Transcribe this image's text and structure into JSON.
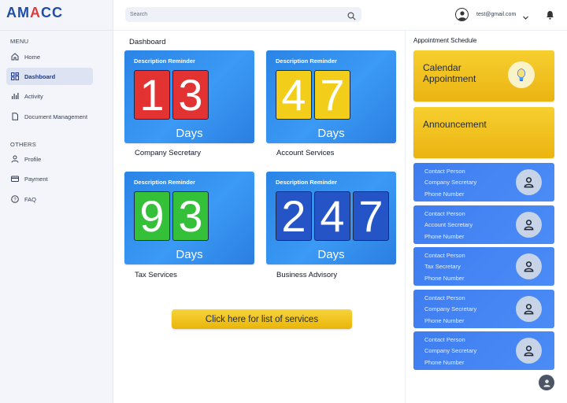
{
  "brand": {
    "logo_text_a": "AM",
    "logo_text_b": "A",
    "logo_text_c": "CC"
  },
  "sidebar": {
    "menu_heading": "MENU",
    "items": [
      {
        "label": "Home",
        "icon": "home-icon"
      },
      {
        "label": "Dashboard",
        "icon": "dashboard-icon",
        "active": true
      },
      {
        "label": "Activity",
        "icon": "activity-icon"
      },
      {
        "label": "Document Management",
        "icon": "document-icon"
      }
    ],
    "others_heading": "OTHERS",
    "others": [
      {
        "label": "Profile",
        "icon": "profile-icon"
      },
      {
        "label": "Payment",
        "icon": "payment-icon"
      },
      {
        "label": "FAQ",
        "icon": "help-icon"
      }
    ]
  },
  "header": {
    "search_placeholder": "Search",
    "user_email": "test@gmail.com"
  },
  "main": {
    "title": "Dashboard",
    "cards": [
      {
        "heading": "Description Reminder",
        "digits": [
          "1",
          "3"
        ],
        "days_label": "Days",
        "caption": "Company Secretary",
        "digit_color": "#e23232"
      },
      {
        "heading": "Description Reminder",
        "digits": [
          "4",
          "7"
        ],
        "days_label": "Days",
        "caption": "Account Services",
        "digit_color": "#f2cd1a"
      },
      {
        "heading": "Description Reminder",
        "digits": [
          "9",
          "3"
        ],
        "days_label": "Days",
        "caption": "Tax Services",
        "digit_color": "#35c03a"
      },
      {
        "heading": "Description Reminder",
        "digits": [
          "2",
          "4",
          "7"
        ],
        "days_label": "Days",
        "caption": "Business Advisory",
        "digit_color": "#2554c7"
      }
    ],
    "cta_label": "Click here for list of services"
  },
  "right_panel": {
    "title": "Appointment Schedule",
    "calendar_label_line1": "Calendar",
    "calendar_label_line2": "Appointment",
    "announcement_label": "Announcement",
    "contacts": [
      {
        "line1": "Contact Person",
        "line2": "Company Secretary",
        "line3": "Phone Number"
      },
      {
        "line1": "Contact Person",
        "line2": "Account Secretary",
        "line3": "Phone Number"
      },
      {
        "line1": "Contact Person",
        "line2": "Tax Secretary",
        "line3": "Phone Number"
      },
      {
        "line1": "Contact Person",
        "line2": "Company Secretary",
        "line3": "Phone Number"
      },
      {
        "line1": "Contact Person",
        "line2": "Company Secretary",
        "line3": "Phone Number"
      }
    ]
  },
  "colors": {
    "primary": "#1d4ea8",
    "accent": "#e23b3b",
    "card_blue": "#2a84e6",
    "yellow": "#f2c41c",
    "contact_blue": "#4283f3"
  }
}
